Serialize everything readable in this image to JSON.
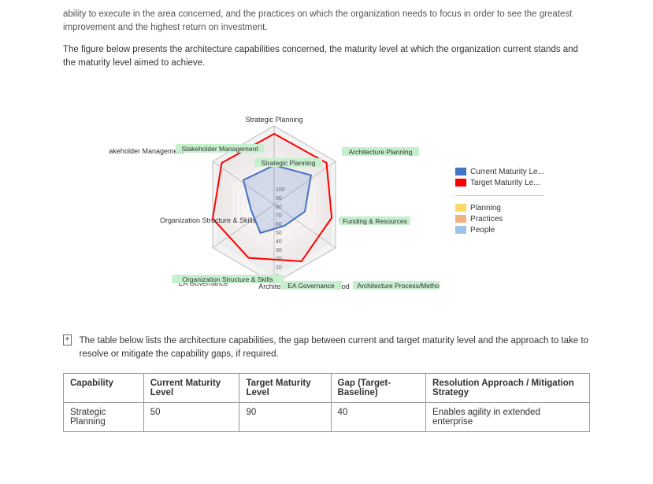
{
  "intro": {
    "text1": "ability to execute in the area concerned, and the practices on which the organization needs to focus in order to see the greatest improvement and the highest return on investment.",
    "text2": "The figure below presents the architecture capabilities concerned, the maturity level at which the organization current stands and the maturity level aimed to achieve."
  },
  "chart": {
    "labels": [
      "Strategic Planning",
      "Architecture Planning",
      "Funding & Resources",
      "Architecture Process/Method",
      "EA Governance",
      "Organization Structure & Skills",
      "Stakeholder Management"
    ],
    "scale": [
      10,
      20,
      30,
      40,
      50,
      60,
      70,
      80,
      90,
      100
    ],
    "currentValues": [
      50,
      60,
      40,
      30,
      40,
      30,
      50
    ],
    "targetValues": [
      90,
      85,
      75,
      80,
      75,
      80,
      85
    ]
  },
  "legend": {
    "items": [
      {
        "label": "Current Maturity Le...",
        "color": "#4472C4"
      },
      {
        "label": "Target Maturity Le...",
        "color": "#FF0000"
      }
    ],
    "categories": [
      {
        "label": "Planning",
        "color": "#FFD966"
      },
      {
        "label": "Practices",
        "color": "#F4B183"
      },
      {
        "label": "People",
        "color": "#9DC3E6"
      }
    ]
  },
  "table": {
    "intro": "The table below lists the architecture capabilities, the gap between current and target maturity level and the approach to take to resolve or mitigate the capability gaps, if required.",
    "headers": [
      "Capability",
      "Current Maturity Level",
      "Target Maturity Level",
      "Gap (Target-Baseline)",
      "Resolution Approach / Mitigation Strategy"
    ],
    "rows": [
      {
        "capability": "Strategic Planning",
        "current": "50",
        "target": "90",
        "gap": "40",
        "resolution": "Enables agility in extended enterprise"
      }
    ]
  }
}
